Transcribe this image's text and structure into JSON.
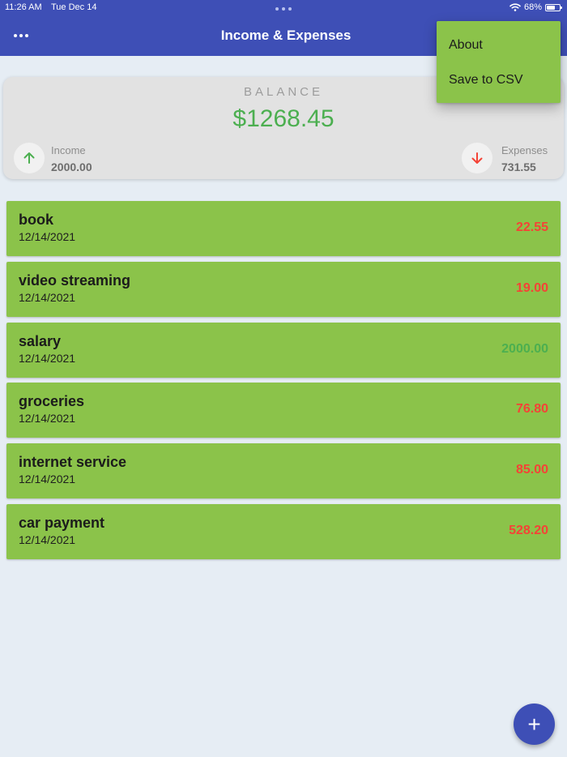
{
  "status_bar": {
    "time": "11:26 AM",
    "date": "Tue Dec 14",
    "battery": "68%",
    "battery_level": 0.68
  },
  "app_bar": {
    "title": "Income & Expenses",
    "menu_icon": "more-horizontal-icon"
  },
  "menu": {
    "items": [
      {
        "label": "About"
      },
      {
        "label": "Save to CSV"
      }
    ]
  },
  "balance": {
    "label": "BALANCE",
    "amount": "$1268.45",
    "income_label": "Income",
    "income_value": "2000.00",
    "income_icon": "arrow-up-icon",
    "expenses_label": "Expenses",
    "expenses_value": "731.55",
    "expenses_icon": "arrow-down-icon"
  },
  "transactions": [
    {
      "name": "book",
      "date": "12/14/2021",
      "amount": "22.55",
      "type": "expense"
    },
    {
      "name": "video streaming",
      "date": "12/14/2021",
      "amount": "19.00",
      "type": "expense"
    },
    {
      "name": "salary",
      "date": "12/14/2021",
      "amount": "2000.00",
      "type": "income"
    },
    {
      "name": "groceries",
      "date": "12/14/2021",
      "amount": "76.80",
      "type": "expense"
    },
    {
      "name": "internet service",
      "date": "12/14/2021",
      "amount": "85.00",
      "type": "expense"
    },
    {
      "name": "car payment",
      "date": "12/14/2021",
      "amount": "528.20",
      "type": "expense"
    }
  ],
  "fab": {
    "icon": "plus-icon",
    "label": "+"
  },
  "colors": {
    "primary": "#3e4fb6",
    "card": "#8bc34a",
    "income": "#4caf50",
    "expense": "#f44336",
    "background": "#e6edf4"
  }
}
